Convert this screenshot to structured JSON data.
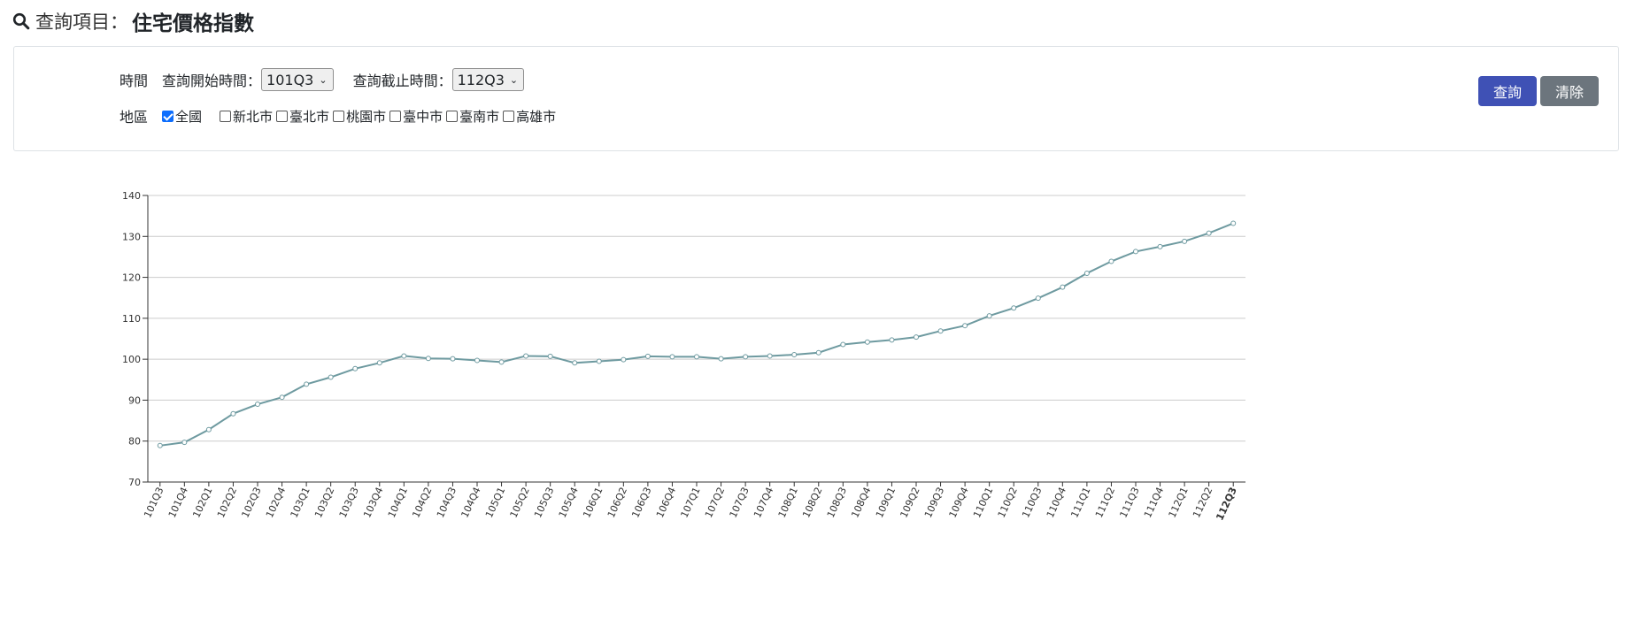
{
  "header": {
    "prefix": "查詢項目：",
    "title": "住宅價格指數"
  },
  "filters": {
    "time_label": "時間",
    "start_label": "查詢開始時間：",
    "start_value": "101Q3",
    "end_label": "查詢截止時間：",
    "end_value": "112Q3",
    "region_label": "地區",
    "regions": [
      {
        "label": "全國",
        "checked": true
      },
      {
        "label": "新北市",
        "checked": false
      },
      {
        "label": "臺北市",
        "checked": false
      },
      {
        "label": "桃園市",
        "checked": false
      },
      {
        "label": "臺中市",
        "checked": false
      },
      {
        "label": "臺南市",
        "checked": false
      },
      {
        "label": "高雄市",
        "checked": false
      }
    ]
  },
  "buttons": {
    "query": "查詢",
    "clear": "清除"
  },
  "colors": {
    "series": "#6e9aa0",
    "primary": "#3f51b5",
    "secondary": "#6c757d"
  },
  "chart_data": {
    "type": "line",
    "legend_position": "top-center",
    "grid": true,
    "ylim": [
      70,
      140
    ],
    "yticks": [
      70,
      80,
      90,
      100,
      110,
      120,
      130,
      140
    ],
    "categories": [
      "101Q3",
      "101Q4",
      "102Q1",
      "102Q2",
      "102Q3",
      "102Q4",
      "103Q1",
      "103Q2",
      "103Q3",
      "103Q4",
      "104Q1",
      "104Q2",
      "104Q3",
      "104Q4",
      "105Q1",
      "105Q2",
      "105Q3",
      "105Q4",
      "106Q1",
      "106Q2",
      "106Q3",
      "106Q4",
      "107Q1",
      "107Q2",
      "107Q3",
      "107Q4",
      "108Q1",
      "108Q2",
      "108Q3",
      "108Q4",
      "109Q1",
      "109Q2",
      "109Q3",
      "109Q4",
      "110Q1",
      "110Q2",
      "110Q3",
      "110Q4",
      "111Q1",
      "111Q2",
      "111Q3",
      "111Q4",
      "112Q1",
      "112Q2",
      "112Q3"
    ],
    "series": [
      {
        "name": "全國",
        "values": [
          78.9,
          79.7,
          82.8,
          86.7,
          89.0,
          90.7,
          93.9,
          95.6,
          97.7,
          99.1,
          100.8,
          100.2,
          100.1,
          99.7,
          99.3,
          100.8,
          100.7,
          99.1,
          99.5,
          99.9,
          100.7,
          100.6,
          100.6,
          100.1,
          100.6,
          100.8,
          101.1,
          101.6,
          103.6,
          104.2,
          104.7,
          105.4,
          106.9,
          108.2,
          110.6,
          112.5,
          114.9,
          117.6,
          121.0,
          123.9,
          126.3,
          127.5,
          128.8,
          130.8,
          133.2
        ]
      }
    ]
  }
}
